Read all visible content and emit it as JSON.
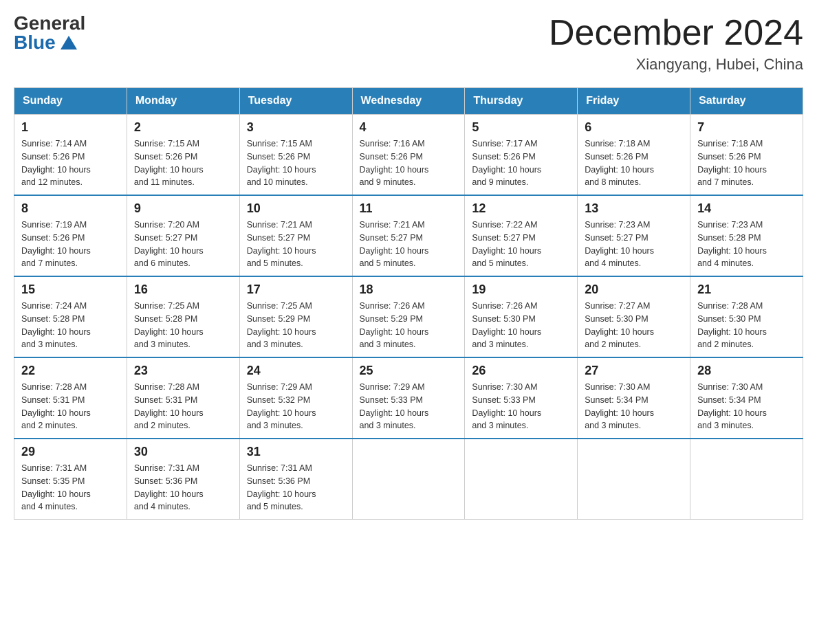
{
  "logo": {
    "general": "General",
    "blue": "Blue"
  },
  "title": "December 2024",
  "location": "Xiangyang, Hubei, China",
  "days_of_week": [
    "Sunday",
    "Monday",
    "Tuesday",
    "Wednesday",
    "Thursday",
    "Friday",
    "Saturday"
  ],
  "weeks": [
    [
      {
        "day": "1",
        "sunrise": "7:14 AM",
        "sunset": "5:26 PM",
        "daylight": "10 hours and 12 minutes."
      },
      {
        "day": "2",
        "sunrise": "7:15 AM",
        "sunset": "5:26 PM",
        "daylight": "10 hours and 11 minutes."
      },
      {
        "day": "3",
        "sunrise": "7:15 AM",
        "sunset": "5:26 PM",
        "daylight": "10 hours and 10 minutes."
      },
      {
        "day": "4",
        "sunrise": "7:16 AM",
        "sunset": "5:26 PM",
        "daylight": "10 hours and 9 minutes."
      },
      {
        "day": "5",
        "sunrise": "7:17 AM",
        "sunset": "5:26 PM",
        "daylight": "10 hours and 9 minutes."
      },
      {
        "day": "6",
        "sunrise": "7:18 AM",
        "sunset": "5:26 PM",
        "daylight": "10 hours and 8 minutes."
      },
      {
        "day": "7",
        "sunrise": "7:18 AM",
        "sunset": "5:26 PM",
        "daylight": "10 hours and 7 minutes."
      }
    ],
    [
      {
        "day": "8",
        "sunrise": "7:19 AM",
        "sunset": "5:26 PM",
        "daylight": "10 hours and 7 minutes."
      },
      {
        "day": "9",
        "sunrise": "7:20 AM",
        "sunset": "5:27 PM",
        "daylight": "10 hours and 6 minutes."
      },
      {
        "day": "10",
        "sunrise": "7:21 AM",
        "sunset": "5:27 PM",
        "daylight": "10 hours and 5 minutes."
      },
      {
        "day": "11",
        "sunrise": "7:21 AM",
        "sunset": "5:27 PM",
        "daylight": "10 hours and 5 minutes."
      },
      {
        "day": "12",
        "sunrise": "7:22 AM",
        "sunset": "5:27 PM",
        "daylight": "10 hours and 5 minutes."
      },
      {
        "day": "13",
        "sunrise": "7:23 AM",
        "sunset": "5:27 PM",
        "daylight": "10 hours and 4 minutes."
      },
      {
        "day": "14",
        "sunrise": "7:23 AM",
        "sunset": "5:28 PM",
        "daylight": "10 hours and 4 minutes."
      }
    ],
    [
      {
        "day": "15",
        "sunrise": "7:24 AM",
        "sunset": "5:28 PM",
        "daylight": "10 hours and 3 minutes."
      },
      {
        "day": "16",
        "sunrise": "7:25 AM",
        "sunset": "5:28 PM",
        "daylight": "10 hours and 3 minutes."
      },
      {
        "day": "17",
        "sunrise": "7:25 AM",
        "sunset": "5:29 PM",
        "daylight": "10 hours and 3 minutes."
      },
      {
        "day": "18",
        "sunrise": "7:26 AM",
        "sunset": "5:29 PM",
        "daylight": "10 hours and 3 minutes."
      },
      {
        "day": "19",
        "sunrise": "7:26 AM",
        "sunset": "5:30 PM",
        "daylight": "10 hours and 3 minutes."
      },
      {
        "day": "20",
        "sunrise": "7:27 AM",
        "sunset": "5:30 PM",
        "daylight": "10 hours and 2 minutes."
      },
      {
        "day": "21",
        "sunrise": "7:28 AM",
        "sunset": "5:30 PM",
        "daylight": "10 hours and 2 minutes."
      }
    ],
    [
      {
        "day": "22",
        "sunrise": "7:28 AM",
        "sunset": "5:31 PM",
        "daylight": "10 hours and 2 minutes."
      },
      {
        "day": "23",
        "sunrise": "7:28 AM",
        "sunset": "5:31 PM",
        "daylight": "10 hours and 2 minutes."
      },
      {
        "day": "24",
        "sunrise": "7:29 AM",
        "sunset": "5:32 PM",
        "daylight": "10 hours and 3 minutes."
      },
      {
        "day": "25",
        "sunrise": "7:29 AM",
        "sunset": "5:33 PM",
        "daylight": "10 hours and 3 minutes."
      },
      {
        "day": "26",
        "sunrise": "7:30 AM",
        "sunset": "5:33 PM",
        "daylight": "10 hours and 3 minutes."
      },
      {
        "day": "27",
        "sunrise": "7:30 AM",
        "sunset": "5:34 PM",
        "daylight": "10 hours and 3 minutes."
      },
      {
        "day": "28",
        "sunrise": "7:30 AM",
        "sunset": "5:34 PM",
        "daylight": "10 hours and 3 minutes."
      }
    ],
    [
      {
        "day": "29",
        "sunrise": "7:31 AM",
        "sunset": "5:35 PM",
        "daylight": "10 hours and 4 minutes."
      },
      {
        "day": "30",
        "sunrise": "7:31 AM",
        "sunset": "5:36 PM",
        "daylight": "10 hours and 4 minutes."
      },
      {
        "day": "31",
        "sunrise": "7:31 AM",
        "sunset": "5:36 PM",
        "daylight": "10 hours and 5 minutes."
      },
      null,
      null,
      null,
      null
    ]
  ],
  "labels": {
    "sunrise": "Sunrise:",
    "sunset": "Sunset:",
    "daylight": "Daylight:"
  }
}
